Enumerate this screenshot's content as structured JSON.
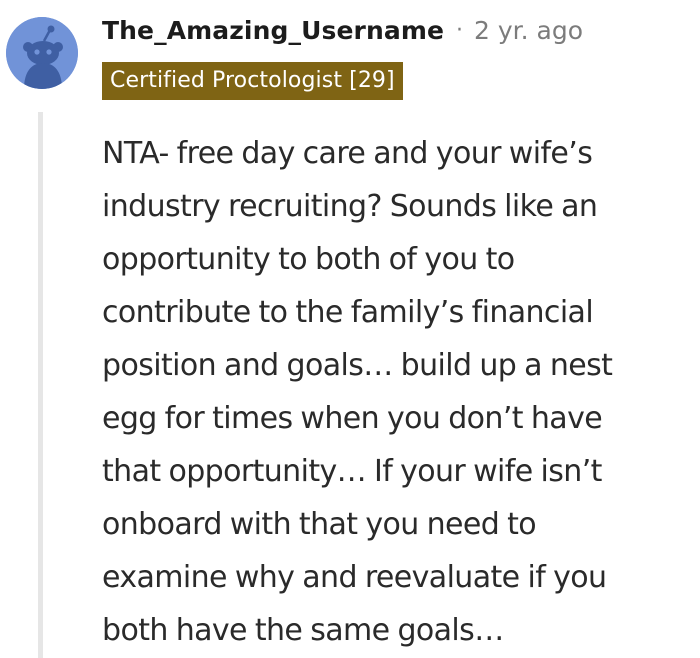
{
  "comment": {
    "avatar_icon": "reddit-snoo-avatar-icon",
    "username": "The_Amazing_Username",
    "separator": "·",
    "timestamp": "2 yr. ago",
    "flair": {
      "text": "Certified Proctologist [29]",
      "background_color": "#7f6414",
      "text_color": "#ffffff"
    },
    "body_lines": [
      "NTA- free day care and your wife’s",
      "industry recruiting? Sounds like an",
      "opportunity to both of you to",
      "contribute to the family’s financial",
      "position and goals… build up a nest",
      "egg for times when you don’t have",
      "that opportunity… If your wife isn’t",
      "onboard with that you need to",
      "examine why and reevaluate if you",
      "both have the same goals…"
    ]
  },
  "colors": {
    "avatar_background": "#7193d8",
    "username": "#1c1c1c",
    "meta_text": "#7c7c7c",
    "body_text": "#2a2a2a",
    "thread_line": "#e6e6e6"
  }
}
